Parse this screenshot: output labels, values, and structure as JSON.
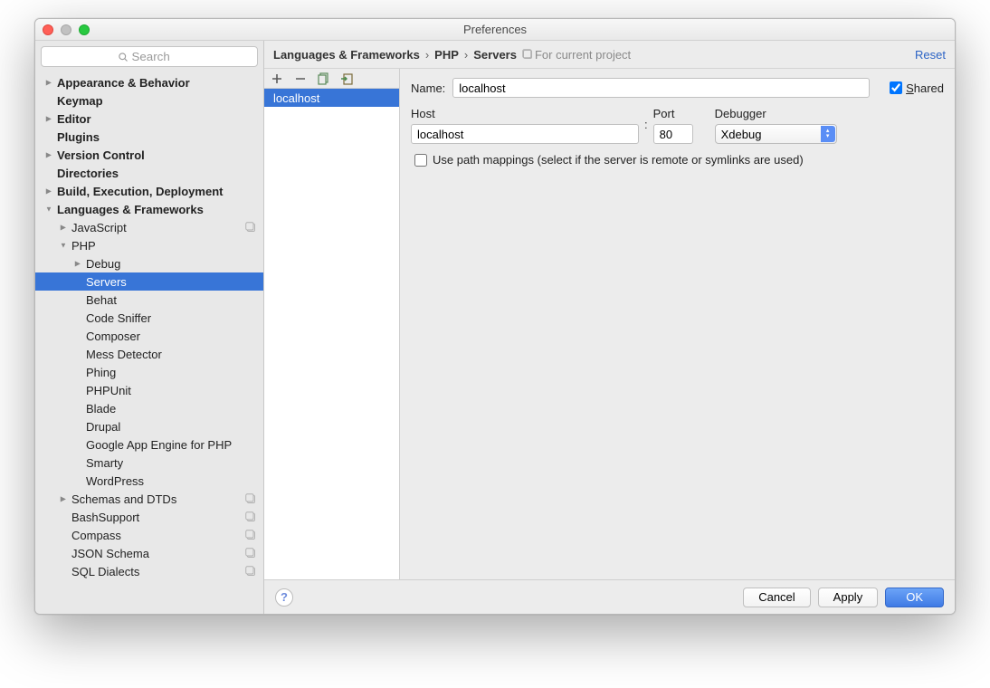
{
  "window": {
    "title": "Preferences"
  },
  "search": {
    "placeholder": "Search"
  },
  "sidebar": {
    "items": [
      {
        "label": "Appearance & Behavior",
        "bold": true,
        "indent": 0,
        "arrow": "collapsed"
      },
      {
        "label": "Keymap",
        "bold": true,
        "indent": 0
      },
      {
        "label": "Editor",
        "bold": true,
        "indent": 0,
        "arrow": "collapsed"
      },
      {
        "label": "Plugins",
        "bold": true,
        "indent": 0
      },
      {
        "label": "Version Control",
        "bold": true,
        "indent": 0,
        "arrow": "collapsed"
      },
      {
        "label": "Directories",
        "bold": true,
        "indent": 0
      },
      {
        "label": "Build, Execution, Deployment",
        "bold": true,
        "indent": 0,
        "arrow": "collapsed"
      },
      {
        "label": "Languages & Frameworks",
        "bold": true,
        "indent": 0,
        "arrow": "expanded"
      },
      {
        "label": "JavaScript",
        "indent": 1,
        "arrow": "collapsed",
        "badge": true
      },
      {
        "label": "PHP",
        "indent": 1,
        "arrow": "expanded"
      },
      {
        "label": "Debug",
        "indent": 2,
        "arrow": "collapsed"
      },
      {
        "label": "Servers",
        "indent": 2,
        "selected": true
      },
      {
        "label": "Behat",
        "indent": 2
      },
      {
        "label": "Code Sniffer",
        "indent": 2
      },
      {
        "label": "Composer",
        "indent": 2
      },
      {
        "label": "Mess Detector",
        "indent": 2
      },
      {
        "label": "Phing",
        "indent": 2
      },
      {
        "label": "PHPUnit",
        "indent": 2
      },
      {
        "label": "Blade",
        "indent": 2
      },
      {
        "label": "Drupal",
        "indent": 2
      },
      {
        "label": "Google App Engine for PHP",
        "indent": 2
      },
      {
        "label": "Smarty",
        "indent": 2
      },
      {
        "label": "WordPress",
        "indent": 2
      },
      {
        "label": "Schemas and DTDs",
        "indent": 1,
        "arrow": "collapsed",
        "badge": true
      },
      {
        "label": "BashSupport",
        "indent": 1,
        "badge": true
      },
      {
        "label": "Compass",
        "indent": 1,
        "badge": true
      },
      {
        "label": "JSON Schema",
        "indent": 1,
        "badge": true
      },
      {
        "label": "SQL Dialects",
        "indent": 1,
        "badge": true
      }
    ]
  },
  "breadcrumb": {
    "part1": "Languages & Frameworks",
    "part2": "PHP",
    "part3": "Servers",
    "forProject": "For current project",
    "reset": "Reset"
  },
  "servers": {
    "list": [
      {
        "name": "localhost"
      }
    ]
  },
  "form": {
    "name_label": "Name:",
    "name_value": "localhost",
    "shared_label": "Shared",
    "shared_checked": true,
    "host_label": "Host",
    "host_value": "localhost",
    "port_label": "Port",
    "port_value": "80",
    "debugger_label": "Debugger",
    "debugger_value": "Xdebug",
    "path_mappings_label": "Use path mappings (select if the server is remote or symlinks are used)",
    "path_mappings_checked": false
  },
  "footer": {
    "cancel": "Cancel",
    "apply": "Apply",
    "ok": "OK"
  }
}
